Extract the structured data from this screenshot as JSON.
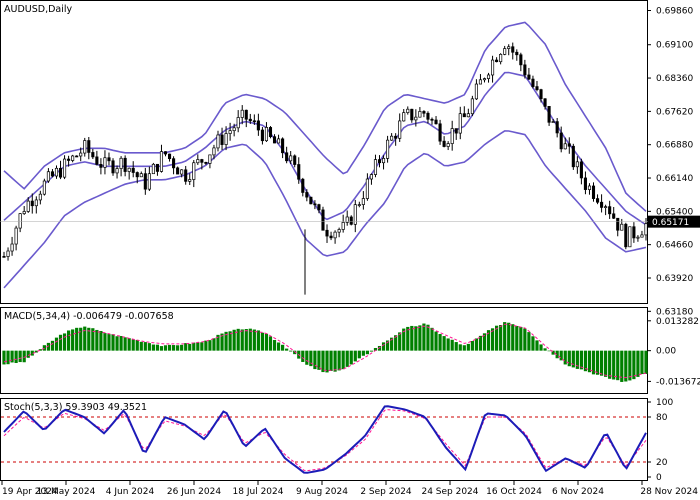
{
  "chart_data": [
    {
      "type": "candlestick",
      "title": "AUDUSD,Daily",
      "ylim": [
        0.6352,
        0.6996
      ],
      "y_ticks": [
        "0.69860",
        "0.69100",
        "0.68360",
        "0.67620",
        "0.66880",
        "0.66140",
        "0.65400",
        "0.64660",
        "0.63920",
        "0.63180"
      ],
      "current_price": "0.65171",
      "series": [
        {
          "name": "bollinger_upper",
          "values": [
            0.663,
            0.659,
            0.664,
            0.667,
            0.668,
            0.668,
            0.667,
            0.667,
            0.667,
            0.668,
            0.671,
            0.678,
            0.68,
            0.679,
            0.676,
            0.671,
            0.666,
            0.662,
            0.669,
            0.677,
            0.68,
            0.679,
            0.678,
            0.68,
            0.69,
            0.695,
            0.696,
            0.691,
            0.682,
            0.675,
            0.668,
            0.658,
            0.654
          ]
        },
        {
          "name": "bollinger_middle",
          "values": [
            0.652,
            0.656,
            0.66,
            0.664,
            0.665,
            0.664,
            0.664,
            0.664,
            0.664,
            0.665,
            0.668,
            0.672,
            0.674,
            0.673,
            0.667,
            0.659,
            0.652,
            0.654,
            0.66,
            0.667,
            0.673,
            0.674,
            0.671,
            0.673,
            0.68,
            0.685,
            0.684,
            0.677,
            0.67,
            0.664,
            0.659,
            0.654,
            0.651
          ]
        },
        {
          "name": "bollinger_lower",
          "values": [
            0.637,
            0.642,
            0.647,
            0.653,
            0.656,
            0.658,
            0.66,
            0.661,
            0.661,
            0.662,
            0.664,
            0.668,
            0.669,
            0.665,
            0.657,
            0.648,
            0.644,
            0.645,
            0.651,
            0.656,
            0.664,
            0.667,
            0.664,
            0.665,
            0.669,
            0.672,
            0.671,
            0.664,
            0.659,
            0.654,
            0.648,
            0.645,
            0.646
          ]
        },
        {
          "name": "price_close",
          "values": [
            0.644,
            0.655,
            0.66,
            0.664,
            0.668,
            0.664,
            0.665,
            0.66,
            0.667,
            0.662,
            0.666,
            0.671,
            0.675,
            0.671,
            0.667,
            0.659,
            0.65,
            0.65,
            0.659,
            0.668,
            0.675,
            0.676,
            0.67,
            0.675,
            0.685,
            0.692,
            0.685,
            0.676,
            0.668,
            0.66,
            0.656,
            0.648,
            0.651
          ]
        }
      ]
    },
    {
      "type": "bar",
      "title": "MACD(5,34,4) -0.006479 -0.007658",
      "ylim": [
        -0.0175,
        0.0172
      ],
      "y_ticks": [
        "0.013282",
        "0.00",
        "-0.013672"
      ],
      "series": [
        {
          "name": "macd_histogram",
          "values": [
            -0.006,
            -0.005,
            0.002,
            0.008,
            0.011,
            0.008,
            0.006,
            0.004,
            0.002,
            0.003,
            0.004,
            0.008,
            0.01,
            0.008,
            0.002,
            -0.006,
            -0.01,
            -0.008,
            -0.002,
            0.004,
            0.01,
            0.012,
            0.006,
            0.002,
            0.008,
            0.013,
            0.01,
            0.001,
            -0.006,
            -0.009,
            -0.012,
            -0.014,
            -0.01
          ]
        },
        {
          "name": "signal",
          "values": [
            -0.005,
            -0.003,
            0.001,
            0.006,
            0.009,
            0.008,
            0.006,
            0.004,
            0.003,
            0.003,
            0.004,
            0.007,
            0.009,
            0.008,
            0.003,
            -0.004,
            -0.009,
            -0.008,
            -0.003,
            0.003,
            0.009,
            0.011,
            0.007,
            0.003,
            0.007,
            0.012,
            0.01,
            0.002,
            -0.005,
            -0.008,
            -0.011,
            -0.012,
            -0.01
          ]
        }
      ]
    },
    {
      "type": "line",
      "title": "Stoch(5,3,3) 59.3903 49.3521",
      "ylim": [
        0,
        100
      ],
      "y_ticks": [
        "100",
        "80",
        "20",
        "0"
      ],
      "levels": [
        80,
        20
      ],
      "series": [
        {
          "name": "stoch_main",
          "values": [
            60,
            88,
            62,
            90,
            80,
            58,
            90,
            30,
            80,
            70,
            50,
            90,
            40,
            65,
            25,
            5,
            10,
            30,
            55,
            95,
            90,
            80,
            40,
            10,
            85,
            82,
            55,
            8,
            25,
            12,
            60,
            10,
            59
          ]
        },
        {
          "name": "stoch_signal",
          "values": [
            55,
            80,
            65,
            85,
            78,
            62,
            85,
            35,
            75,
            68,
            55,
            85,
            45,
            60,
            30,
            8,
            12,
            28,
            50,
            90,
            88,
            78,
            45,
            15,
            80,
            80,
            58,
            12,
            25,
            15,
            55,
            14,
            49
          ]
        }
      ]
    }
  ],
  "x_axis": {
    "dates": [
      "19 Apr 2024",
      "13 May 2024",
      "4 Jun 2024",
      "26 Jun 2024",
      "18 Jul 2024",
      "9 Aug 2024",
      "2 Sep 2024",
      "24 Sep 2024",
      "16 Oct 2024",
      "6 Nov 2024",
      "28 Nov 2024"
    ]
  },
  "colors": {
    "candle": "#000000",
    "bollinger": "#6a5acd",
    "macd_bar": "#008000",
    "macd_signal": "#ff1493",
    "stoch_main": "#1c1cb8",
    "stoch_signal": "#ff1493",
    "level": "#cc0000"
  }
}
